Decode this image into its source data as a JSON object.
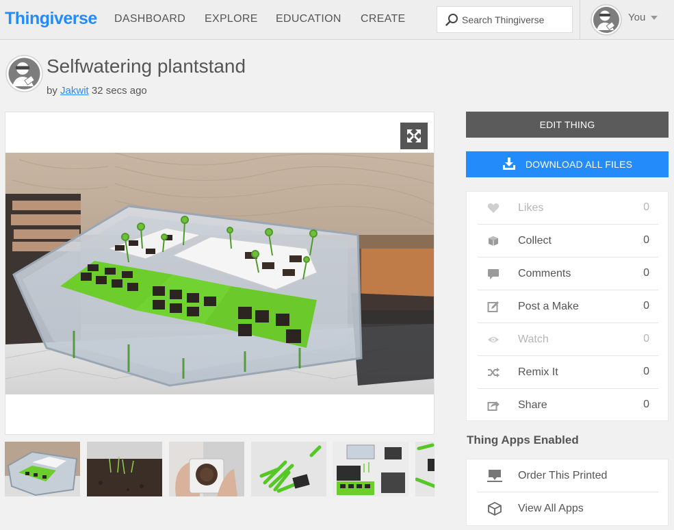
{
  "header": {
    "logo": "Thingiverse",
    "nav": [
      "DASHBOARD",
      "EXPLORE",
      "EDUCATION",
      "CREATE"
    ],
    "search_placeholder": "Search Thingiverse",
    "user_label": "You"
  },
  "thing": {
    "title": "Selfwatering plantstand",
    "by": "by",
    "author": "Jakwit",
    "posted": "32 secs ago"
  },
  "actions": {
    "edit": "EDIT THING",
    "download": "DOWNLOAD ALL FILES"
  },
  "stats": [
    {
      "label": "Likes",
      "count": "0",
      "icon": "heart-icon"
    },
    {
      "label": "Collect",
      "count": "0",
      "icon": "collect-icon"
    },
    {
      "label": "Comments",
      "count": "0",
      "icon": "comments-icon"
    },
    {
      "label": "Post a Make",
      "count": "0",
      "icon": "post-make-icon"
    },
    {
      "label": "Watch",
      "count": "0",
      "icon": "eye-icon"
    },
    {
      "label": "Remix It",
      "count": "0",
      "icon": "remix-icon"
    },
    {
      "label": "Share",
      "count": "0",
      "icon": "share-icon"
    }
  ],
  "apps": {
    "title": "Thing Apps Enabled",
    "items": [
      {
        "label": "Order This Printed",
        "icon": "printer-icon"
      },
      {
        "label": "View All Apps",
        "icon": "cube-icon"
      }
    ]
  },
  "colors": {
    "brand": "#248bfb",
    "edit_button": "#5b5b5b",
    "header_bg": "#eeeeee",
    "page_bg": "#f1f1f1"
  }
}
